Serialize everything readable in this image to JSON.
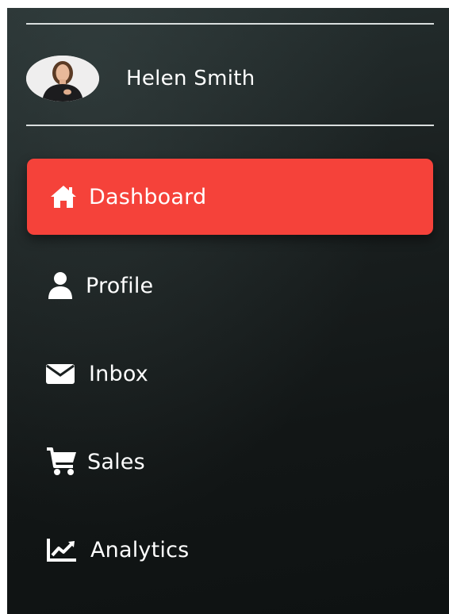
{
  "user": {
    "name": "Helen Smith"
  },
  "nav": {
    "items": [
      {
        "label": "Dashboard",
        "icon": "home-icon",
        "active": true
      },
      {
        "label": "Profile",
        "icon": "user-icon",
        "active": false
      },
      {
        "label": "Inbox",
        "icon": "envelope-icon",
        "active": false
      },
      {
        "label": "Sales",
        "icon": "cart-icon",
        "active": false
      },
      {
        "label": "Analytics",
        "icon": "chart-line-icon",
        "active": false
      }
    ]
  },
  "colors": {
    "active_background": "#f5423a",
    "sidebar_background": "#1a2020",
    "text": "#ffffff",
    "divider": "#d9dede"
  }
}
